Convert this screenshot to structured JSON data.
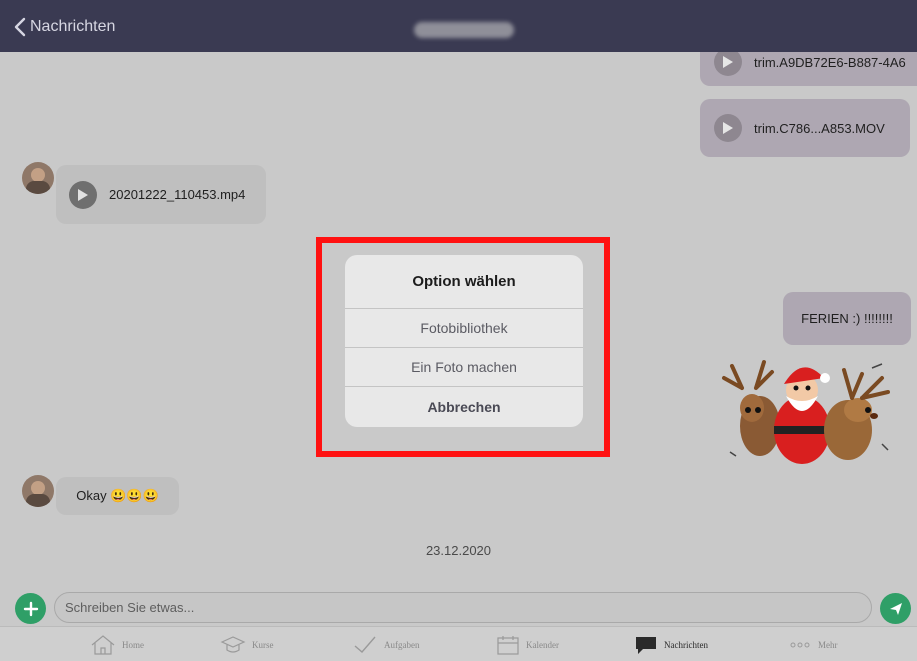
{
  "header": {
    "back_label": "Nachrichten"
  },
  "messages": {
    "out_video_1": "trim.A9DB72E6-B887-4A6",
    "out_video_2": "trim.C786...A853.MOV",
    "in_video_1": "20201222_110453.mp4",
    "out_text_1": "FERIEN :) !!!!!!!!",
    "in_text_1": "Okay 😃😃😃"
  },
  "date_divider": "23.12.2020",
  "dialog": {
    "title": "Option wählen",
    "options": [
      "Fotobibliothek",
      "Ein Foto machen"
    ],
    "cancel": "Abbrechen"
  },
  "composer": {
    "placeholder": "Schreiben Sie etwas..."
  },
  "tabs": [
    {
      "label": "Home",
      "icon": "home-icon"
    },
    {
      "label": "Kurse",
      "icon": "graduation-cap-icon"
    },
    {
      "label": "Aufgaben",
      "icon": "checkmark-icon"
    },
    {
      "label": "Kalender",
      "icon": "calendar-icon"
    },
    {
      "label": "Nachrichten",
      "icon": "chat-bubble-icon",
      "active": true
    },
    {
      "label": "Mehr",
      "icon": "more-dots-icon"
    }
  ],
  "colors": {
    "header_bg": "#3a3a52",
    "accent_green": "#2f9f67",
    "highlight_red": "#ff1111"
  }
}
